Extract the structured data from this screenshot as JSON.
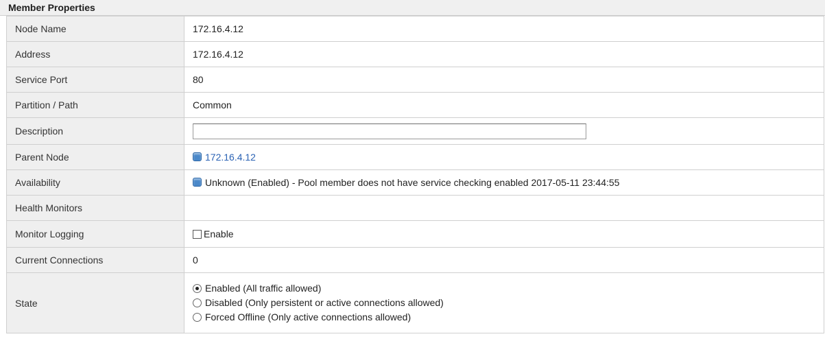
{
  "section": {
    "title": "Member Properties"
  },
  "rows": {
    "node_name": {
      "label": "Node Name",
      "value": "172.16.4.12"
    },
    "address": {
      "label": "Address",
      "value": "172.16.4.12"
    },
    "service_port": {
      "label": "Service Port",
      "value": "80"
    },
    "partition": {
      "label": "Partition / Path",
      "value": "Common"
    },
    "description": {
      "label": "Description",
      "value": "",
      "placeholder": ""
    },
    "parent_node": {
      "label": "Parent Node",
      "value": "172.16.4.12",
      "icon": "status-square-blue-icon"
    },
    "availability": {
      "label": "Availability",
      "value": "Unknown (Enabled) - Pool member does not have service checking enabled 2017-05-11 23:44:55",
      "icon": "status-square-blue-icon"
    },
    "health_monitors": {
      "label": "Health Monitors",
      "value": ""
    },
    "monitor_logging": {
      "label": "Monitor Logging",
      "checkbox_label": "Enable",
      "checked": false
    },
    "current_connections": {
      "label": "Current Connections",
      "value": "0"
    },
    "state": {
      "label": "State",
      "options": [
        {
          "label": "Enabled (All traffic allowed)",
          "checked": true
        },
        {
          "label": "Disabled (Only persistent or active connections allowed)",
          "checked": false
        },
        {
          "label": "Forced Offline (Only active connections allowed)",
          "checked": false
        }
      ]
    }
  },
  "colors": {
    "link": "#2a62b4",
    "status_blue": "#4a88c9",
    "label_bg": "#efefef",
    "border": "#cfcfcf"
  }
}
